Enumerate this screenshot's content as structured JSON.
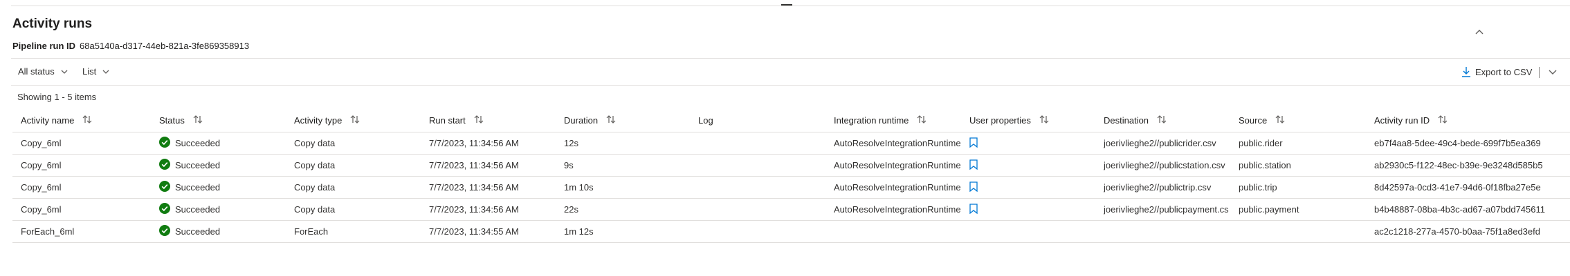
{
  "panel": {
    "title": "Activity runs",
    "pipeline_run_id_label": "Pipeline run ID",
    "pipeline_run_id": "68a5140a-d317-44eb-821a-3fe869358913"
  },
  "filters": {
    "status_label": "All status",
    "view_label": "List"
  },
  "toolbar": {
    "export_label": "Export to CSV"
  },
  "showing_text": "Showing 1 - 5 items",
  "colors": {
    "success": "#107c10",
    "accent": "#0078d4"
  },
  "table": {
    "columns": [
      {
        "label": "Activity name",
        "sortable": true
      },
      {
        "label": "Status",
        "sortable": true
      },
      {
        "label": "Activity type",
        "sortable": true
      },
      {
        "label": "Run start",
        "sortable": true
      },
      {
        "label": "Duration",
        "sortable": true
      },
      {
        "label": "Log",
        "sortable": false
      },
      {
        "label": "Integration runtime",
        "sortable": true
      },
      {
        "label": "User properties",
        "sortable": true
      },
      {
        "label": "Destination",
        "sortable": true
      },
      {
        "label": "Source",
        "sortable": true
      },
      {
        "label": "Activity run ID",
        "sortable": true
      }
    ],
    "rows": [
      {
        "activity_name": "Copy_6ml",
        "status": "Succeeded",
        "activity_type": "Copy data",
        "run_start": "7/7/2023, 11:34:56 AM",
        "duration": "12s",
        "log": "",
        "integration_runtime": "AutoResolveIntegrationRuntime",
        "user_properties": true,
        "destination": "joerivlieghe2//publicrider.csv",
        "source": "public.rider",
        "activity_run_id": "eb7f4aa8-5dee-49c4-bede-699f7b5ea369"
      },
      {
        "activity_name": "Copy_6ml",
        "status": "Succeeded",
        "activity_type": "Copy data",
        "run_start": "7/7/2023, 11:34:56 AM",
        "duration": "9s",
        "log": "",
        "integration_runtime": "AutoResolveIntegrationRuntime",
        "user_properties": true,
        "destination": "joerivlieghe2//publicstation.csv",
        "source": "public.station",
        "activity_run_id": "ab2930c5-f122-48ec-b39e-9e3248d585b5"
      },
      {
        "activity_name": "Copy_6ml",
        "status": "Succeeded",
        "activity_type": "Copy data",
        "run_start": "7/7/2023, 11:34:56 AM",
        "duration": "1m 10s",
        "log": "",
        "integration_runtime": "AutoResolveIntegrationRuntime",
        "user_properties": true,
        "destination": "joerivlieghe2//publictrip.csv",
        "source": "public.trip",
        "activity_run_id": "8d42597a-0cd3-41e7-94d6-0f18fba27e5e"
      },
      {
        "activity_name": "Copy_6ml",
        "status": "Succeeded",
        "activity_type": "Copy data",
        "run_start": "7/7/2023, 11:34:56 AM",
        "duration": "22s",
        "log": "",
        "integration_runtime": "AutoResolveIntegrationRuntime",
        "user_properties": true,
        "destination": "joerivlieghe2//publicpayment.cs",
        "source": "public.payment",
        "activity_run_id": "b4b48887-08ba-4b3c-ad67-a07bdd745611"
      },
      {
        "activity_name": "ForEach_6ml",
        "status": "Succeeded",
        "activity_type": "ForEach",
        "run_start": "7/7/2023, 11:34:55 AM",
        "duration": "1m 12s",
        "log": "",
        "integration_runtime": "",
        "user_properties": false,
        "destination": "",
        "source": "",
        "activity_run_id": "ac2c1218-277a-4570-b0aa-75f1a8ed3efd"
      }
    ]
  }
}
